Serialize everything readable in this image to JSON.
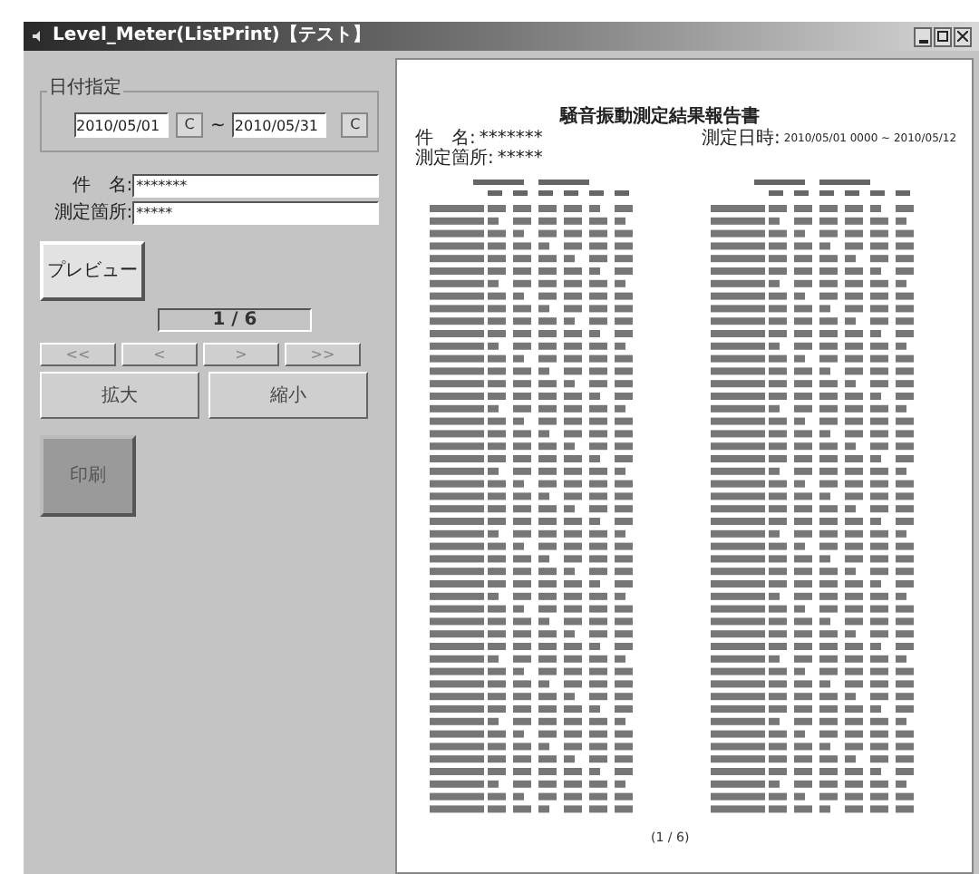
{
  "window": {
    "title": "Level_Meter(ListPrint)【テスト】"
  },
  "date_range": {
    "label": "日付指定",
    "from": "2010/05/01",
    "from_button": "C",
    "separator": "~",
    "to": "2010/05/31",
    "to_button": "C"
  },
  "fields": [
    {
      "label": "件　名:",
      "value": "*******"
    },
    {
      "label": "測定箇所:",
      "value": "*****"
    }
  ],
  "preview_button": "プレビュー",
  "page_indicator": "1 / 6",
  "nav_buttons": [
    "<<",
    "<",
    ">",
    ">>"
  ],
  "zoom_buttons": [
    "拡大",
    "縮小"
  ],
  "print_button": {
    "label": "印刷",
    "disabled": true
  },
  "preview": {
    "title": "騒音振動測定結果報告書",
    "subject": {
      "label": "件　名:",
      "value": "*******"
    },
    "location": {
      "label": "測定箇所:",
      "value": "*****"
    },
    "date": {
      "label": "測定日時:",
      "value": "2010/05/01 0000 ~ 2010/05/12"
    },
    "footer": "(1 / 6)"
  }
}
